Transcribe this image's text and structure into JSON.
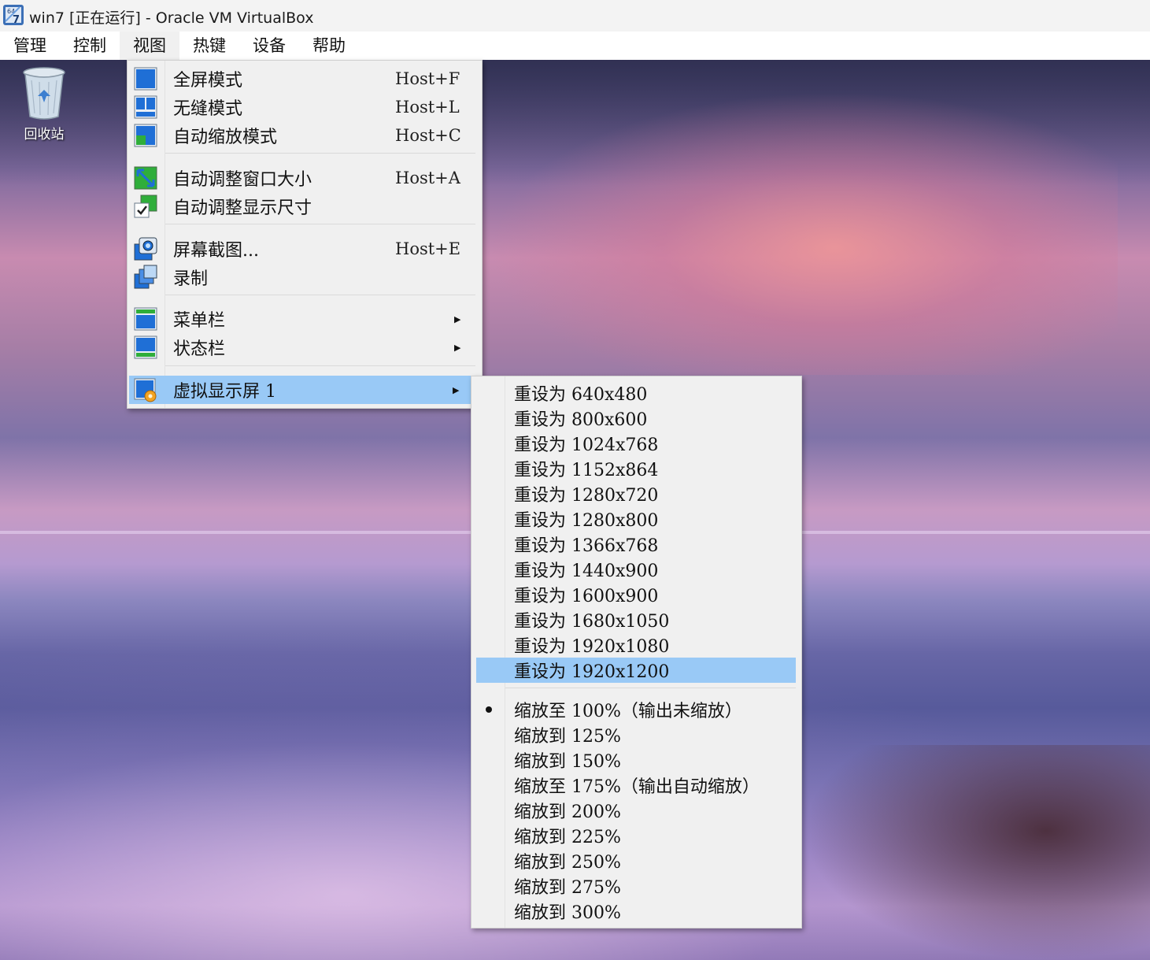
{
  "window": {
    "title": "win7 [正在运行] - Oracle VM VirtualBox"
  },
  "menubar": {
    "items": [
      "管理",
      "控制",
      "视图",
      "热键",
      "设备",
      "帮助"
    ],
    "active": "视图"
  },
  "desktop": {
    "recycle_bin_label": "回收站"
  },
  "view_menu": {
    "items": [
      {
        "label": "全屏模式",
        "shortcut": "Host+F",
        "icon": "fullscreen-icon"
      },
      {
        "label": "无缝模式",
        "shortcut": "Host+L",
        "icon": "seamless-icon"
      },
      {
        "label": "自动缩放模式",
        "shortcut": "Host+C",
        "icon": "scale-mode-icon"
      },
      {
        "label": "自动调整窗口大小",
        "shortcut": "Host+A",
        "icon": "adjust-window-icon"
      },
      {
        "label": "自动调整显示尺寸",
        "shortcut": "",
        "icon": "auto-resize-guest-icon"
      },
      {
        "label": "屏幕截图...",
        "shortcut": "Host+E",
        "icon": "screenshot-icon"
      },
      {
        "label": "录制",
        "shortcut": "",
        "icon": "recording-icon"
      },
      {
        "label": "菜单栏",
        "shortcut": "",
        "icon": "menubar-icon",
        "submenu": true
      },
      {
        "label": "状态栏",
        "shortcut": "",
        "icon": "statusbar-icon",
        "submenu": true
      },
      {
        "label": "虚拟显示屏 1",
        "shortcut": "",
        "icon": "virtual-screen-icon",
        "submenu": true,
        "highlighted": true
      }
    ]
  },
  "display_submenu": {
    "resize_items": [
      "重设为 640x480",
      "重设为 800x600",
      "重设为 1024x768",
      "重设为 1152x864",
      "重设为 1280x720",
      "重设为 1280x800",
      "重设为 1366x768",
      "重设为 1440x900",
      "重设为 1600x900",
      "重设为 1680x1050",
      "重设为 1920x1080",
      "重设为 1920x1200"
    ],
    "highlighted_resize": "重设为 1920x1200",
    "scale_items": [
      "缩放至 100%（输出未缩放）",
      "缩放到 125%",
      "缩放到 150%",
      "缩放至 175%（输出自动缩放）",
      "缩放到 200%",
      "缩放到 225%",
      "缩放到 250%",
      "缩放到 275%",
      "缩放到 300%"
    ],
    "checked_scale": "缩放至 100%（输出未缩放）"
  },
  "colors": {
    "menu_bg": "#f0f0f0",
    "highlight": "#99c9f6",
    "icon_blue": "#1f6fd6",
    "icon_green": "#2fae3a"
  }
}
